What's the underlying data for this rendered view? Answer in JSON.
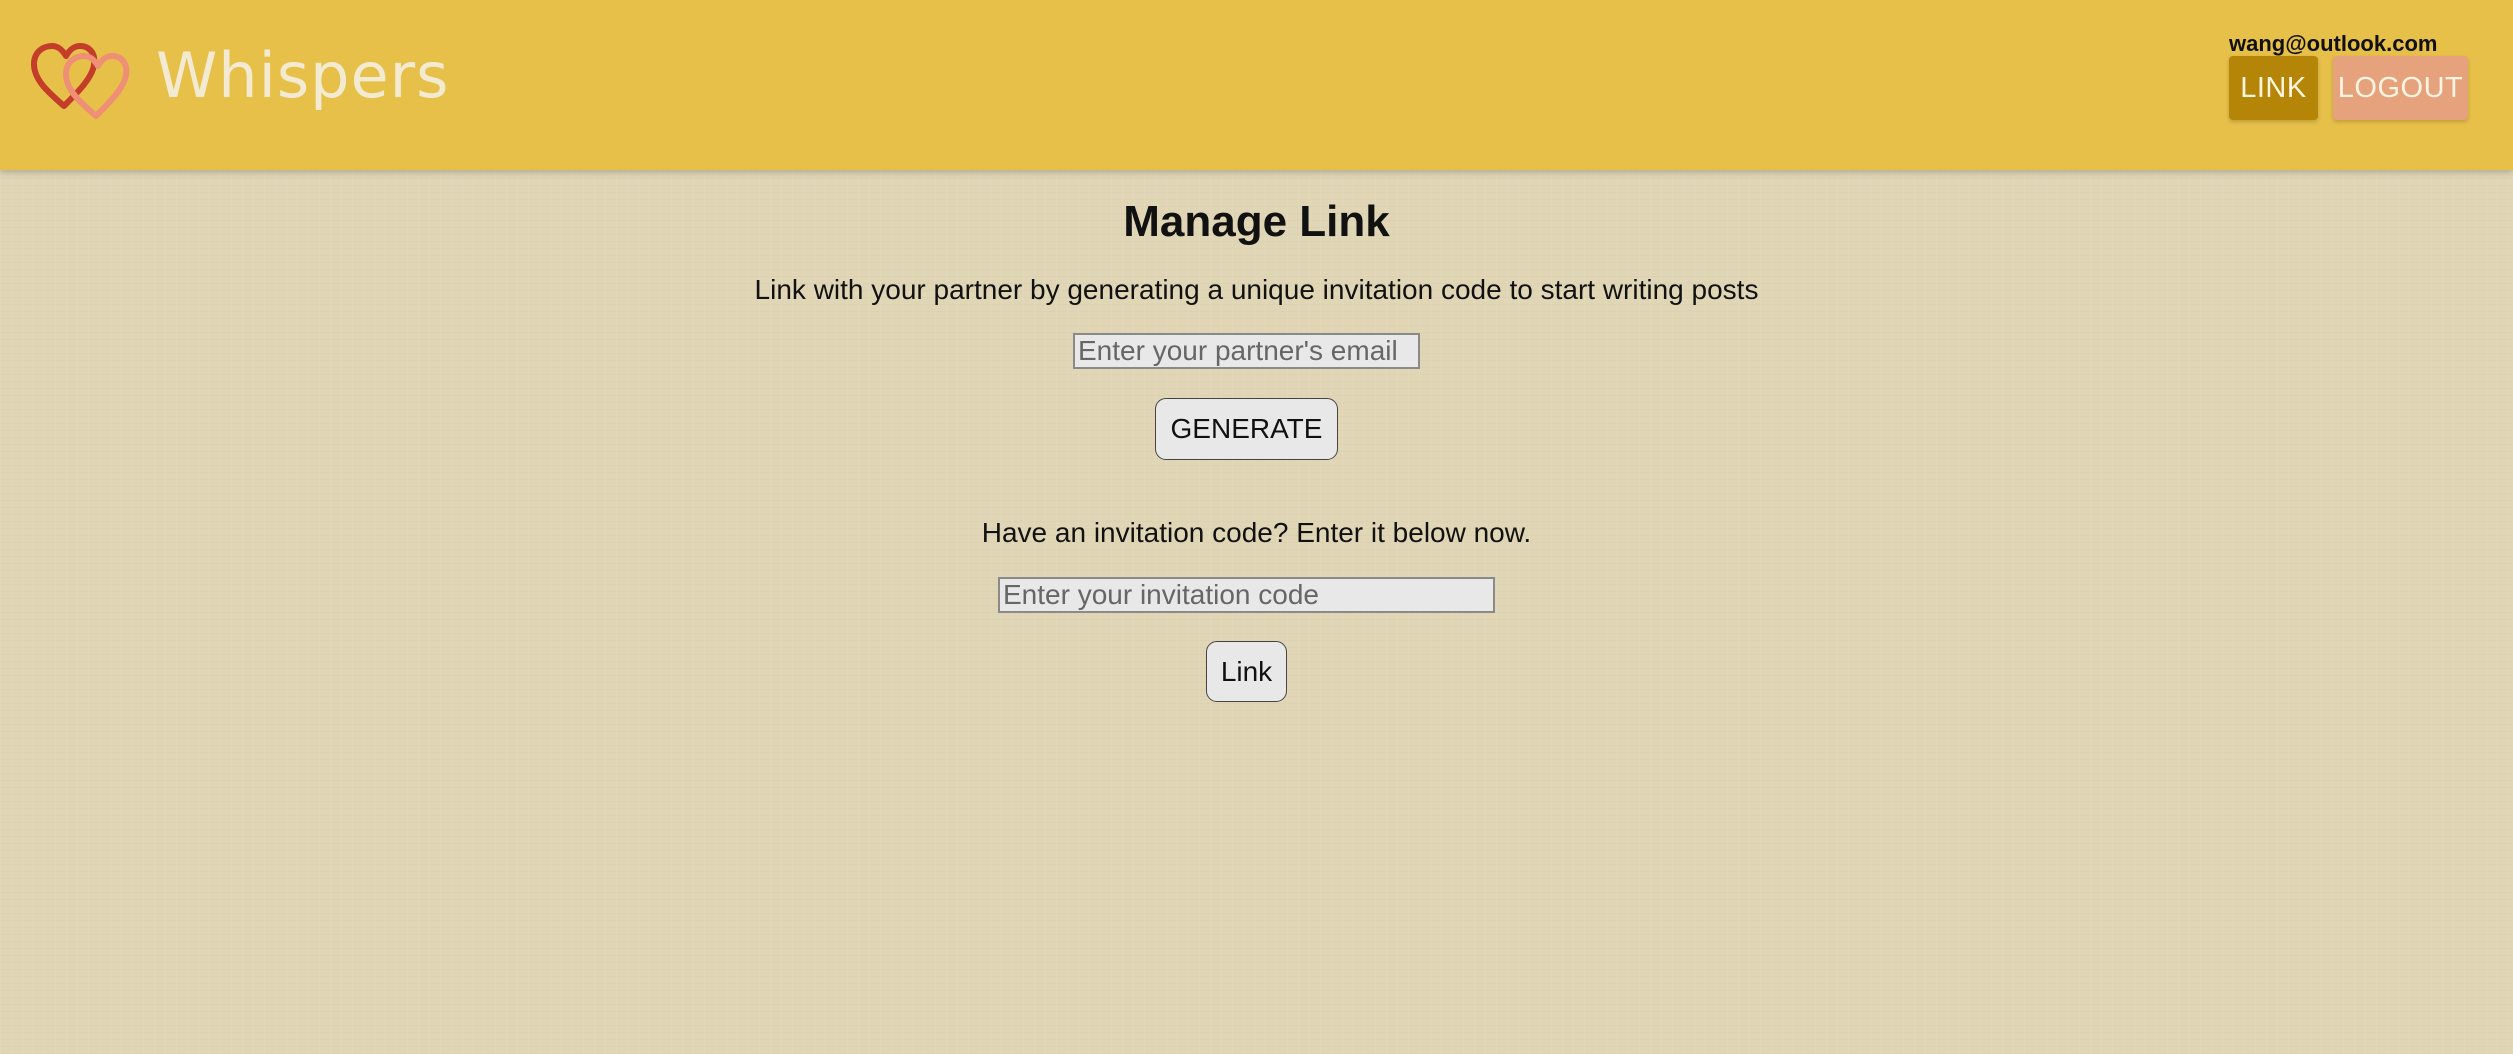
{
  "header": {
    "brand_name": "Whispers",
    "logo_icon": "two-hearts-icon",
    "user_email": "wang@outlook.com",
    "nav": {
      "link_label": "LINK",
      "logout_label": "LOGOUT"
    },
    "colors": {
      "header_bg": "#e7c04a",
      "link_button": "#b48506",
      "logout_button": "#e6a17d"
    }
  },
  "main": {
    "title": "Manage Link",
    "intro": "Link with your partner by generating a unique invitation code to start writing posts",
    "email_input": {
      "placeholder": "Enter your partner's email",
      "value": ""
    },
    "generate_label": "GENERATE",
    "code_prompt": "Have an invitation code? Enter it below now.",
    "code_input": {
      "placeholder": "Enter your invitation code",
      "value": ""
    },
    "link_label": "Link"
  }
}
